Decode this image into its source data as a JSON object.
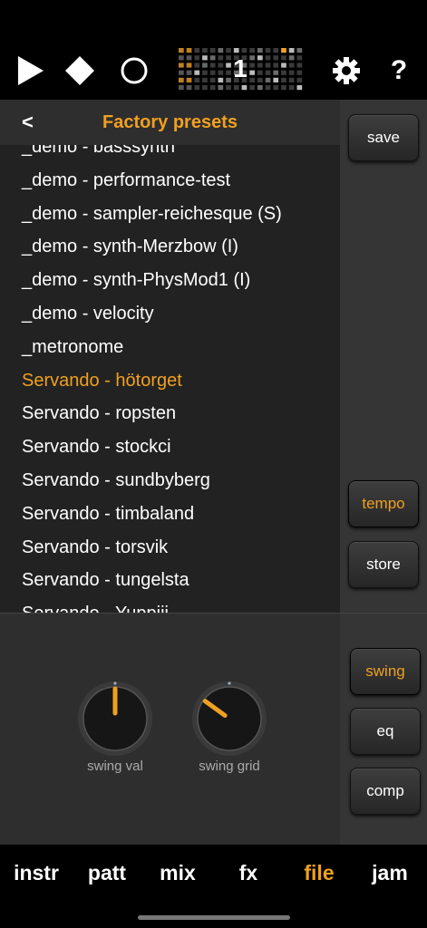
{
  "toolbar": {
    "play_icon": "play-icon",
    "stop_icon": "stop-icon",
    "record_icon": "record-icon",
    "pattern_number": "1",
    "settings_icon": "gear-icon",
    "help_label": "?"
  },
  "presets": {
    "back_label": "<",
    "title": "Factory presets",
    "items": [
      "_demo - basssynth",
      "_demo - performance-test",
      "_demo - sampler-reichesque (S)",
      "_demo - synth-Merzbow (I)",
      "_demo - synth-PhysMod1 (I)",
      "_demo - velocity",
      "_metronome",
      "Servando - hötorget",
      "Servando - ropsten",
      "Servando - stockci",
      "Servando - sundbyberg",
      "Servando - timbaland",
      "Servando - torsvik",
      "Servando - tungelsta",
      "Servando - Yuppiii"
    ],
    "selected": "Servando - hötorget"
  },
  "side_buttons": {
    "save": "save",
    "tempo": "tempo",
    "store": "store",
    "swing": "swing",
    "eq": "eq",
    "comp": "comp"
  },
  "knobs": {
    "swing_val": {
      "label": "swing val",
      "level": 0.5
    },
    "swing_grid": {
      "label": "swing grid",
      "level": 0.3
    }
  },
  "nav": {
    "tabs": [
      "instr",
      "patt",
      "mix",
      "fx",
      "file",
      "jam"
    ],
    "active": "file"
  },
  "colors": {
    "accent": "#f0a020",
    "background": "#2b2b2b",
    "bar": "#000000"
  }
}
